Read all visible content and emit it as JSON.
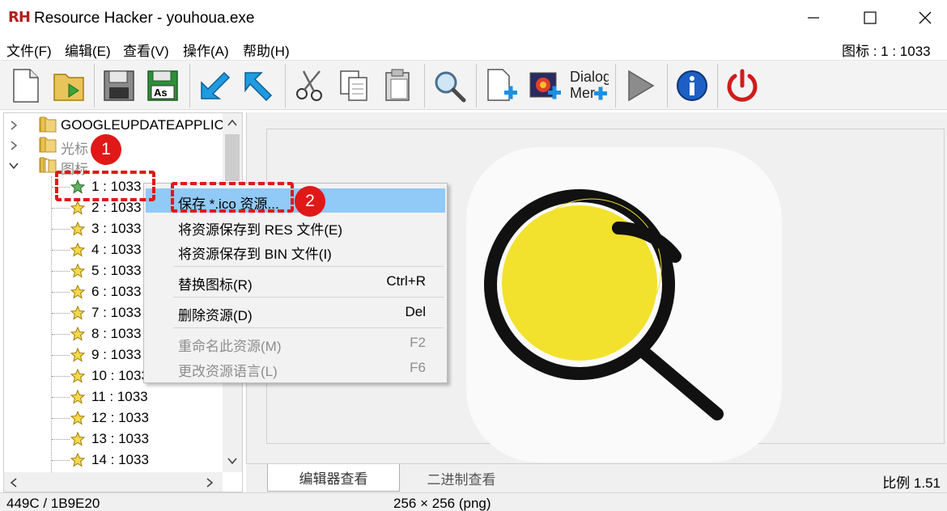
{
  "window": {
    "title": "Resource Hacker - youhoua.exe",
    "logo_r": "R",
    "logo_h": "H"
  },
  "menu": {
    "items": [
      "文件(F)",
      "编辑(E)",
      "查看(V)",
      "操作(A)",
      "帮助(H)"
    ],
    "right_label": "图标  : 1 : 1033"
  },
  "toolbar": {
    "buttons": [
      "new-file",
      "open-file",
      "save",
      "save-as",
      "back",
      "forward",
      "cut",
      "copy",
      "paste",
      "find",
      "add-blank-resource",
      "add-image-resource",
      "add-dialog-menu",
      "run-script",
      "about",
      "exit"
    ],
    "dialog_text_1": "Dialog",
    "dialog_text_2": "Mer"
  },
  "tree": {
    "top_nodes": [
      {
        "label": "GOOGLEUPDATEAPPLICA",
        "expanded": false
      },
      {
        "label": "光标",
        "expanded": false
      },
      {
        "label": "图标",
        "expanded": true
      }
    ],
    "children": [
      "1 : 1033",
      "2 : 1033",
      "3 : 1033",
      "4 : 1033",
      "5 : 1033",
      "6 : 1033",
      "7 : 1033",
      "8 : 1033",
      "9 : 1033",
      "10 : 1033",
      "11 : 1033",
      "12 : 1033",
      "13 : 1033",
      "14 : 1033"
    ]
  },
  "context_menu": {
    "items": [
      {
        "label": "保存 *.ico 资源...",
        "shortcut": "",
        "highlighted": true,
        "disabled": false
      },
      {
        "label": "将资源保存到 RES 文件(E)",
        "shortcut": "",
        "highlighted": false,
        "disabled": false
      },
      {
        "label": "将资源保存到 BIN 文件(I)",
        "shortcut": "",
        "highlighted": false,
        "disabled": false
      },
      {
        "label": "替换图标(R)",
        "shortcut": "Ctrl+R",
        "highlighted": false,
        "disabled": false
      },
      {
        "label": "删除资源(D)",
        "shortcut": "Del",
        "highlighted": false,
        "disabled": false
      },
      {
        "label": "重命名此资源(M)",
        "shortcut": "F2",
        "highlighted": false,
        "disabled": true
      },
      {
        "label": "更改资源语言(L)",
        "shortcut": "F6",
        "highlighted": false,
        "disabled": true
      }
    ]
  },
  "callouts": {
    "step1": "1",
    "step2": "2"
  },
  "tabs": {
    "active": "编辑器查看",
    "inactive": "二进制查看",
    "zoom": "比例 1.51"
  },
  "status": {
    "offset": "449C / 1B9E20",
    "image_info": "256 × 256 (png)"
  },
  "colors": {
    "highlight": "#91c9f7",
    "callout_red": "#e01818",
    "icon_yellow": "#f2e22e",
    "toolbar_bg": "#f3f3f3"
  }
}
